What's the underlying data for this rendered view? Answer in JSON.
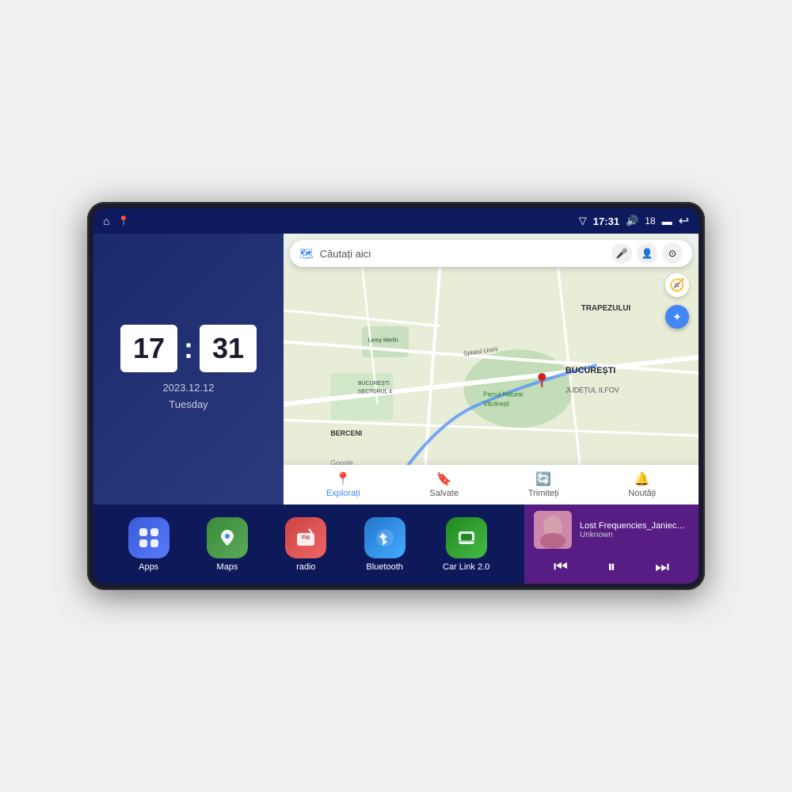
{
  "device": {
    "status_bar": {
      "left_icons": [
        "home",
        "maps"
      ],
      "time": "17:31",
      "signal": "▽",
      "volume": "🔊",
      "battery_level": "18",
      "battery": "▬",
      "back": "↩"
    }
  },
  "clock": {
    "hour": "17",
    "minute": "31",
    "date": "2023.12.12",
    "day": "Tuesday"
  },
  "map": {
    "search_placeholder": "Căutați aici",
    "bottom_buttons": [
      {
        "label": "Explorați",
        "active": true,
        "icon": "📍"
      },
      {
        "label": "Salvate",
        "active": false,
        "icon": "🔖"
      },
      {
        "label": "Trimiteți",
        "active": false,
        "icon": "🔄"
      },
      {
        "label": "Noutăți",
        "active": false,
        "icon": "🔔"
      }
    ],
    "labels": [
      "TRAPEZULUI",
      "BUCUREȘTI",
      "JUDEȚUL ILFOV",
      "BERCENI",
      "Parcul Natural Văcărești",
      "Leroy Merlin",
      "BUCUREȘTI SECTORUL 4"
    ]
  },
  "apps": [
    {
      "id": "apps",
      "label": "Apps",
      "icon": "⊞",
      "color_class": "icon-apps"
    },
    {
      "id": "maps",
      "label": "Maps",
      "icon": "📍",
      "color_class": "icon-maps"
    },
    {
      "id": "radio",
      "label": "radio",
      "icon": "📻",
      "color_class": "icon-radio"
    },
    {
      "id": "bluetooth",
      "label": "Bluetooth",
      "icon": "⬡",
      "color_class": "icon-bluetooth"
    },
    {
      "id": "carlink",
      "label": "Car Link 2.0",
      "icon": "📱",
      "color_class": "icon-carlink"
    }
  ],
  "music": {
    "title": "Lost Frequencies_Janieck Devy-...",
    "artist": "Unknown",
    "controls": {
      "prev": "⏮",
      "play_pause": "⏸",
      "next": "⏭"
    }
  }
}
